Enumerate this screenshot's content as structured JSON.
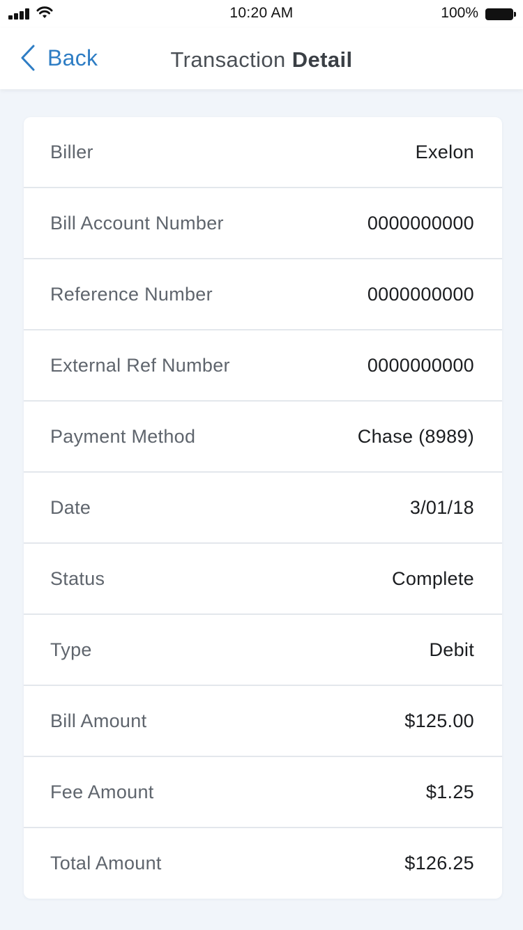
{
  "status_bar": {
    "time": "10:20 AM",
    "battery_percent": "100%",
    "icons": [
      "signal-icon",
      "wifi-icon",
      "battery-icon"
    ]
  },
  "nav": {
    "back_label": "Back",
    "title_regular": "Transaction",
    "title_bold": "Detail",
    "accent_color": "#2e7dc4"
  },
  "details": [
    {
      "label": "Biller",
      "value": "Exelon"
    },
    {
      "label": "Bill Account Number",
      "value": "0000000000"
    },
    {
      "label": "Reference Number",
      "value": "0000000000"
    },
    {
      "label": "External Ref Number",
      "value": "0000000000"
    },
    {
      "label": "Payment Method",
      "value": "Chase (8989)"
    },
    {
      "label": "Date",
      "value": "3/01/18"
    },
    {
      "label": "Status",
      "value": "Complete"
    },
    {
      "label": "Type",
      "value": "Debit"
    },
    {
      "label": "Bill Amount",
      "value": "$125.00"
    },
    {
      "label": "Fee Amount",
      "value": "$1.25"
    },
    {
      "label": "Total Amount",
      "value": "$126.25"
    }
  ]
}
